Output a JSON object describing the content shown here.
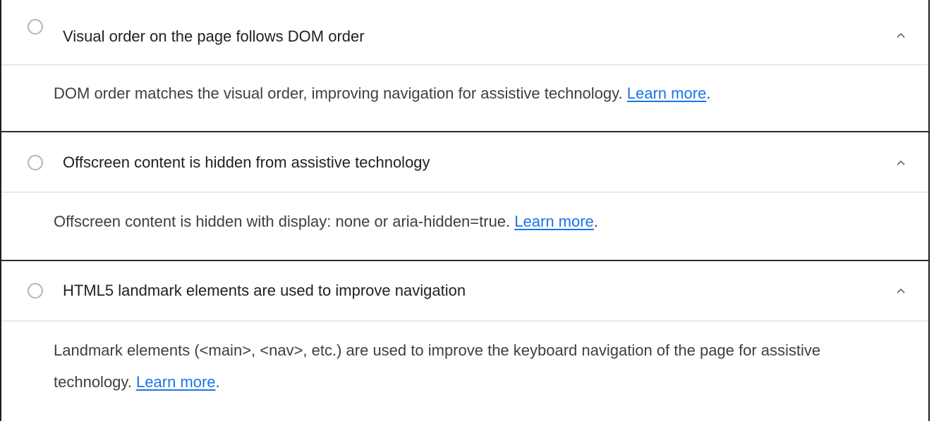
{
  "colors": {
    "status_icon_border": "#b5b5b5",
    "link": "#1a73e8",
    "separator_light": "#e9e9e9",
    "separator_dark": "#2b2b2b"
  },
  "audits": [
    {
      "status_icon": "circle-outline-icon",
      "title": "Visual order on the page follows DOM order",
      "description": "DOM order matches the visual order, improving navigation for assistive technology.",
      "link_text": "Learn more",
      "suffix": ".",
      "chevron_icon": "chevron-up-icon"
    },
    {
      "status_icon": "circle-outline-icon",
      "title": "Offscreen content is hidden from assistive technology",
      "description": "Offscreen content is hidden with display: none or aria-hidden=true.",
      "link_text": "Learn more",
      "suffix": ".",
      "chevron_icon": "chevron-up-icon"
    },
    {
      "status_icon": "circle-outline-icon",
      "title": "HTML5 landmark elements are used to improve navigation",
      "description": "Landmark elements (<main>, <nav>, etc.) are used to improve the keyboard navigation of the page for assistive technology.",
      "link_text": "Learn more",
      "suffix": ".",
      "chevron_icon": "chevron-up-icon"
    }
  ]
}
